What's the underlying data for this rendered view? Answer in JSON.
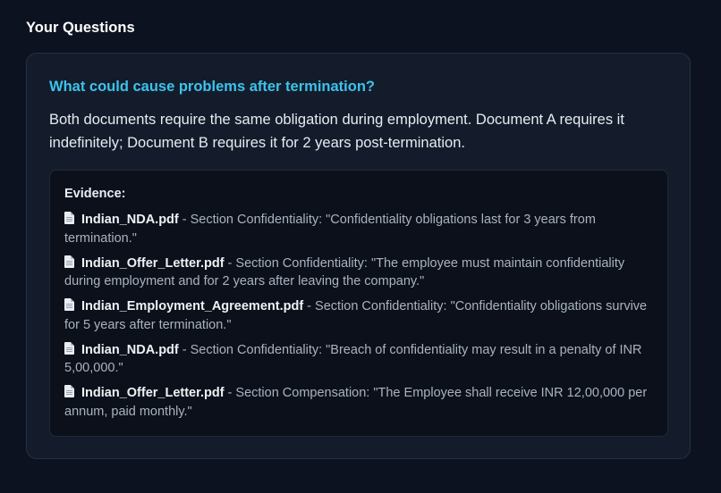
{
  "section": {
    "title": "Your Questions"
  },
  "question": {
    "title": "What could cause problems after termination?",
    "answer": "Both documents require the same obligation during employment. Document A requires it indefinitely; Document B requires it for 2 years post-termination."
  },
  "evidence": {
    "heading": "Evidence:",
    "icon": "document-icon",
    "items": [
      {
        "document": "Indian_NDA.pdf",
        "detail": " - Section Confidentiality: \"Confidentiality obligations last for 3 years from termination.\""
      },
      {
        "document": "Indian_Offer_Letter.pdf",
        "detail": " - Section Confidentiality: \"The employee must maintain confidentiality during employment and for 2 years after leaving the company.\""
      },
      {
        "document": "Indian_Employment_Agreement.pdf",
        "detail": " - Section Confidentiality: \"Confidentiality obligations survive for 5 years after termination.\""
      },
      {
        "document": "Indian_NDA.pdf",
        "detail": " - Section Confidentiality: \"Breach of confidentiality may result in a penalty of INR 5,00,000.\""
      },
      {
        "document": "Indian_Offer_Letter.pdf",
        "detail": " - Section Compensation: \"The Employee shall receive INR 12,00,000 per annum, paid monthly.\""
      }
    ]
  },
  "colors": {
    "background": "#0d1220",
    "card": "#141c2b",
    "evidence_box": "#0b101a",
    "accent": "#3cc3ec"
  }
}
